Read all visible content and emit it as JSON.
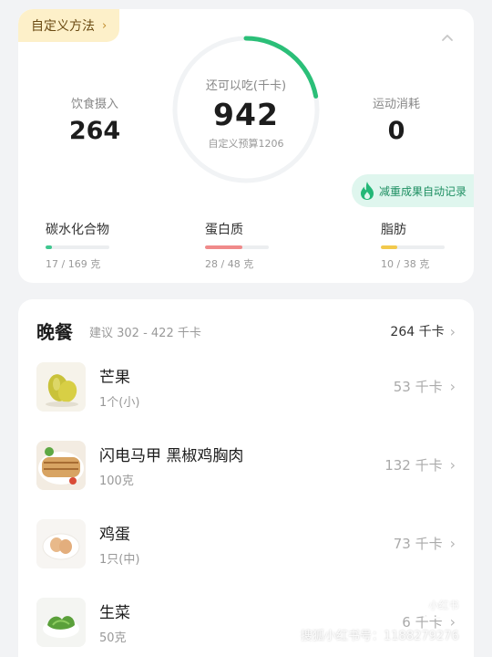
{
  "summary": {
    "method_tag": "自定义方法",
    "intake": {
      "label": "饮食摄入",
      "value": "264"
    },
    "remaining": {
      "label": "还可以吃(千卡)",
      "value": "942",
      "budget": "自定义预算1206",
      "progress": 0.22
    },
    "burn": {
      "label": "运动消耗",
      "value": "0"
    },
    "auto_record": "减重成果自动记录",
    "macros": [
      {
        "name": "碳水化合物",
        "value": "17 / 169 克",
        "ratio": 0.1,
        "color": "#3fc78f"
      },
      {
        "name": "蛋白质",
        "value": "28 / 48 克",
        "ratio": 0.58,
        "color": "#f08a8a"
      },
      {
        "name": "脂肪",
        "value": "10 / 38 克",
        "ratio": 0.26,
        "color": "#f2c94c"
      }
    ],
    "accent": "#2bbf78"
  },
  "meal": {
    "title": "晚餐",
    "suggest": "建议 302 - 422 千卡",
    "total": "264 千卡",
    "items": [
      {
        "name": "芒果",
        "qty": "1个(小)",
        "cal": "53 千卡",
        "icon": "mango-photo"
      },
      {
        "name": "闪电马甲 黑椒鸡胸肉",
        "qty": "100克",
        "cal": "132 千卡",
        "icon": "chicken-breast-photo"
      },
      {
        "name": "鸡蛋",
        "qty": "1只(中)",
        "cal": "73 千卡",
        "icon": "egg-photo"
      },
      {
        "name": "生菜",
        "qty": "50克",
        "cal": "6 千卡",
        "icon": "lettuce-photo"
      }
    ]
  },
  "watermark": {
    "text": "搜狐小红书号：1188279276",
    "logo": "小红书"
  }
}
